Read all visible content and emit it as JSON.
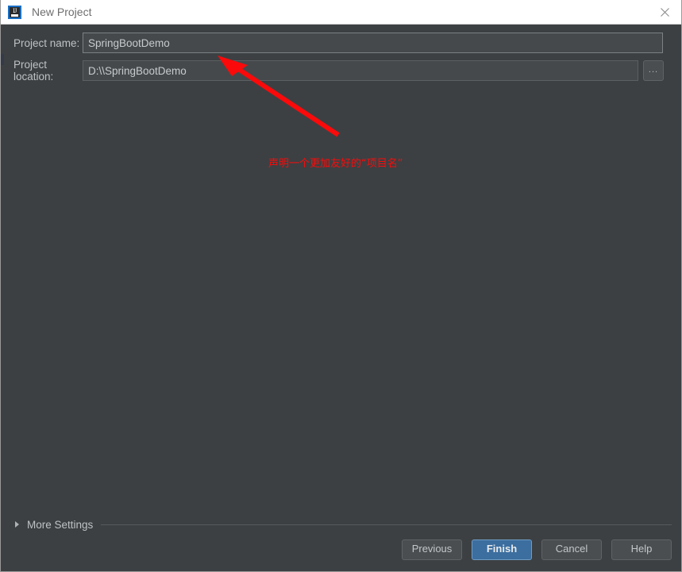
{
  "window": {
    "title": "New Project",
    "app_icon": "intellij-idea-icon",
    "icon_letters": "IJ",
    "close_icon": "close-icon"
  },
  "form": {
    "project_name": {
      "label": "Project name:",
      "value": "SpringBootDemo",
      "placeholder": ""
    },
    "project_location": {
      "label": "Project location:",
      "value": "D:\\\\SpringBootDemo",
      "placeholder": "",
      "browse_label": "..."
    }
  },
  "annotation": {
    "text": "声明一个更加友好的“项目名”",
    "color": "#fa0a0a",
    "arrow_icon": "red-arrow-icon"
  },
  "more_settings": {
    "label": "More Settings",
    "expand_icon": "chevron-right-icon"
  },
  "footer": {
    "buttons": [
      {
        "label": "Previous",
        "default": false
      },
      {
        "label": "Finish",
        "default": true
      },
      {
        "label": "Cancel",
        "default": false
      },
      {
        "label": "Help",
        "default": false
      }
    ]
  },
  "colors": {
    "background": "#3c4043",
    "titlebar": "#ffffff",
    "accent": "#3c6e9f",
    "annotation": "#fa0a0a"
  }
}
